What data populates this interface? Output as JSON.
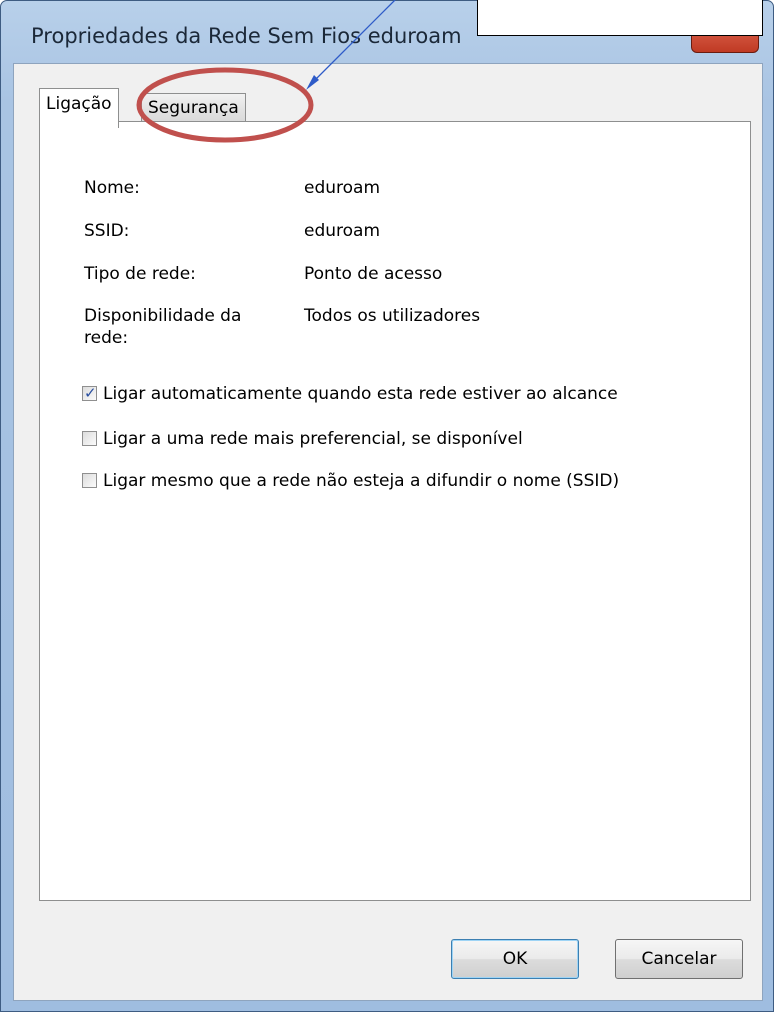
{
  "window": {
    "title": "Propriedades da Rede Sem Fios eduroam"
  },
  "tabs": [
    {
      "label": "Ligação",
      "selected": true
    },
    {
      "label": "Segurança",
      "selected": false
    }
  ],
  "properties": [
    {
      "label": "Nome:",
      "value": "eduroam"
    },
    {
      "label": "SSID:",
      "value": "eduroam"
    },
    {
      "label": "Tipo de rede:",
      "value": "Ponto de acesso"
    },
    {
      "label": "Disponibilidade da rede:",
      "value": "Todos os utilizadores"
    }
  ],
  "options": [
    {
      "label": "Ligar automaticamente quando esta rede estiver ao alcance",
      "checked": true
    },
    {
      "label": "Ligar a uma rede mais preferencial, se disponível",
      "checked": false
    },
    {
      "label": "Ligar mesmo que a rede não esteja a difundir o nome (SSID)",
      "checked": false
    }
  ],
  "buttons": {
    "ok": "OK",
    "cancel": "Cancelar"
  },
  "annotation": {
    "circle_color": "#c0504d",
    "arrow_color": "#2e5bc8"
  }
}
